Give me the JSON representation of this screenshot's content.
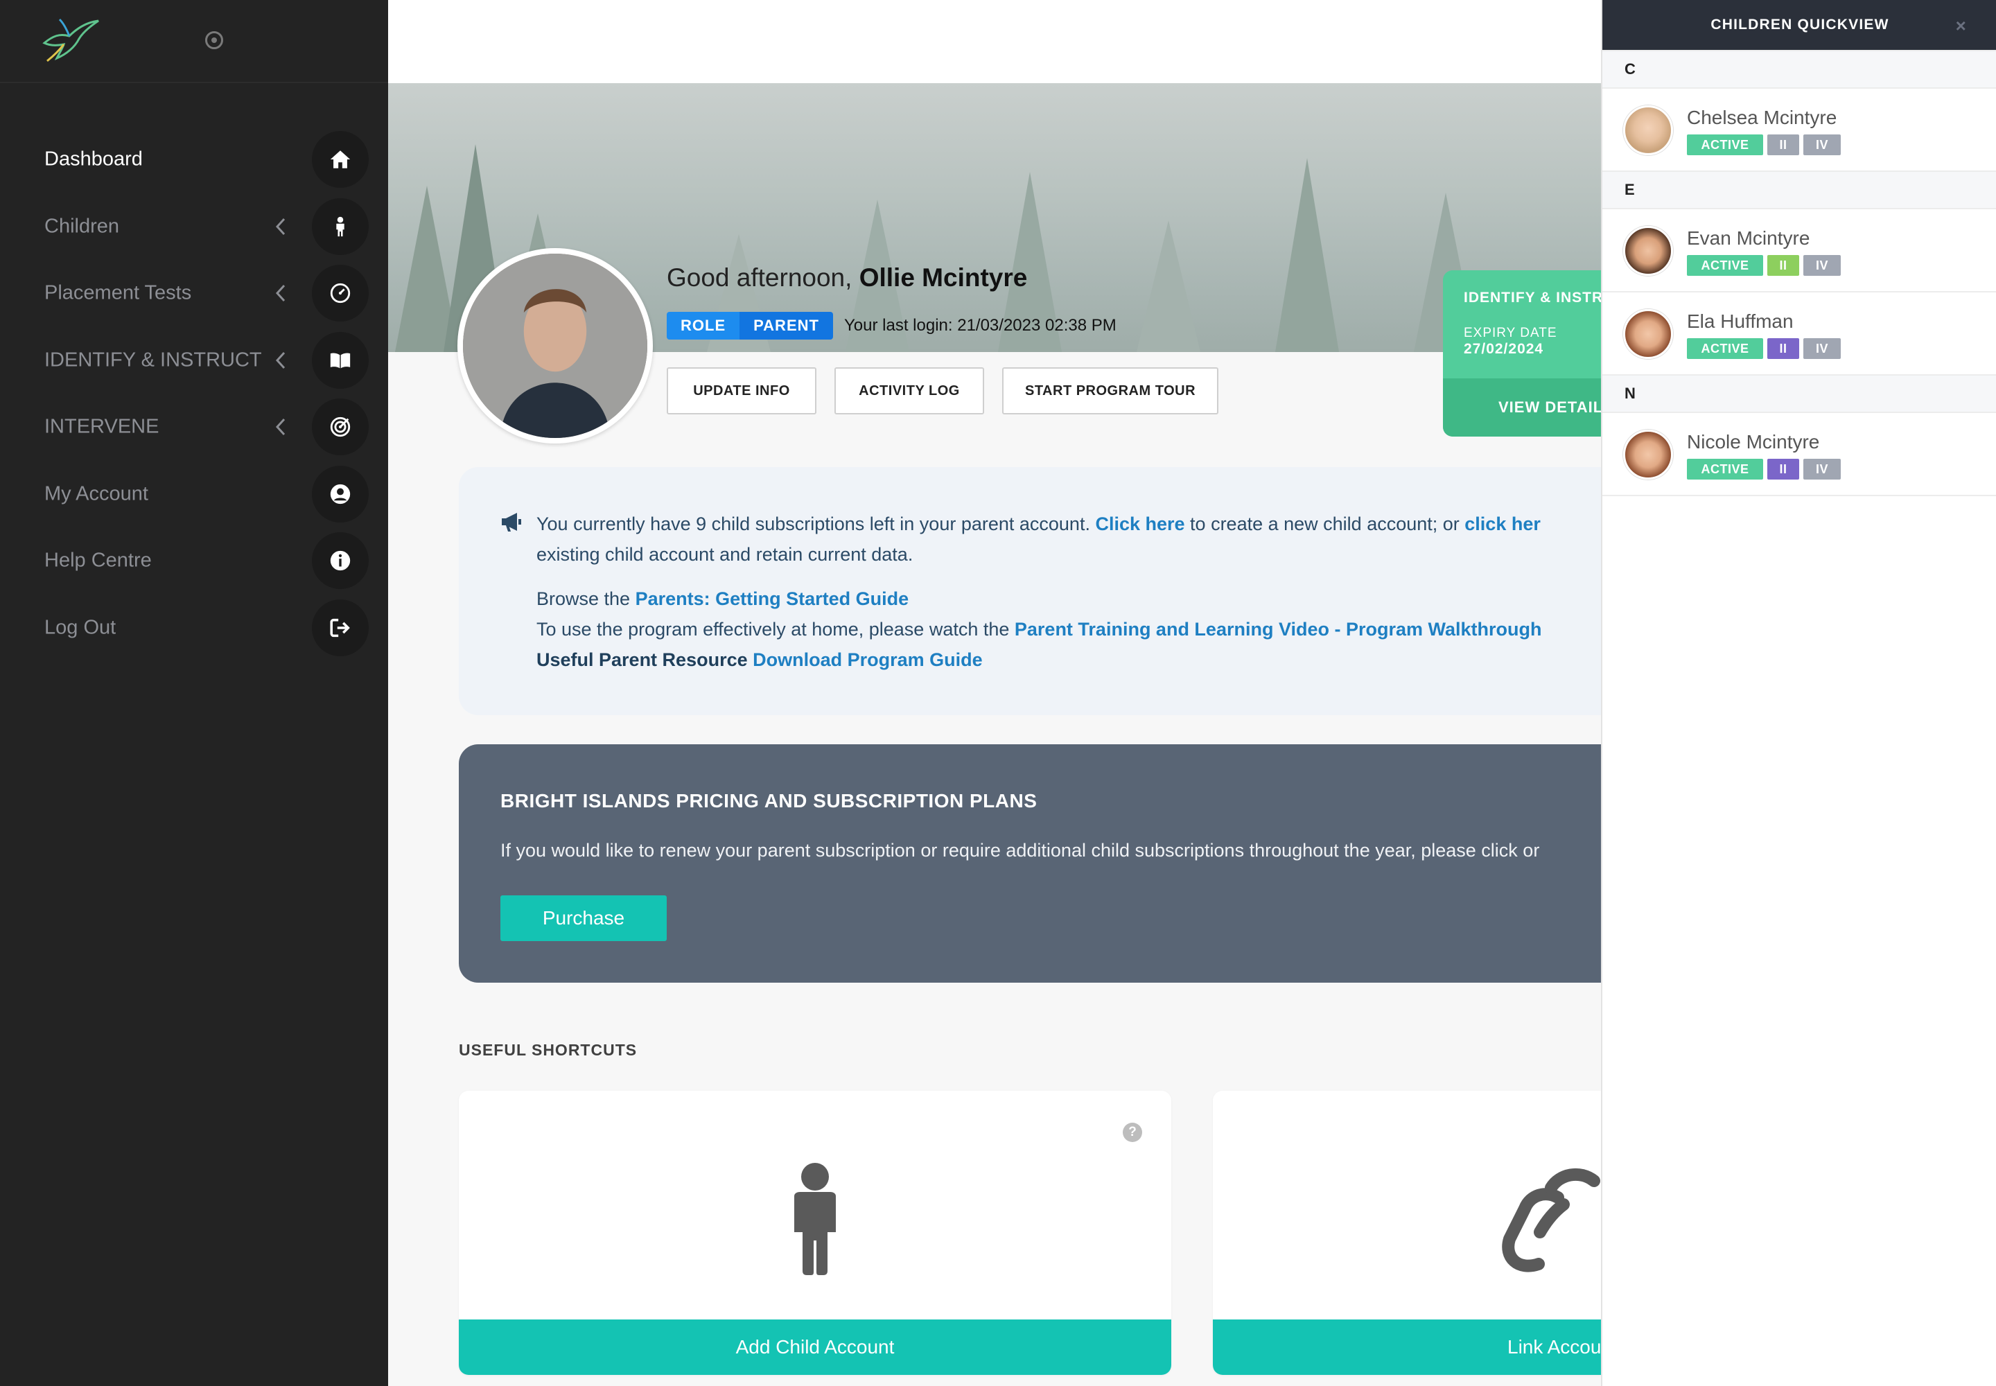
{
  "sidebar": {
    "items": [
      {
        "label": "Dashboard",
        "icon": "home-icon",
        "active": true,
        "has_submenu": false
      },
      {
        "label": "Children",
        "icon": "child-icon",
        "active": false,
        "has_submenu": true
      },
      {
        "label": "Placement Tests",
        "icon": "gauge-icon",
        "active": false,
        "has_submenu": true
      },
      {
        "label": "IDENTIFY & INSTRUCT",
        "icon": "book-icon",
        "active": false,
        "has_submenu": true
      },
      {
        "label": "INTERVENE",
        "icon": "target-icon",
        "active": false,
        "has_submenu": true
      },
      {
        "label": "My Account",
        "icon": "user-circle-icon",
        "active": false,
        "has_submenu": false
      },
      {
        "label": "Help Centre",
        "icon": "info-icon",
        "active": false,
        "has_submenu": false
      },
      {
        "label": "Log Out",
        "icon": "logout-icon",
        "active": false,
        "has_submenu": false
      }
    ]
  },
  "profile": {
    "greeting": "Good afternoon,",
    "name": "Ollie Mcintyre",
    "role_label": "ROLE",
    "role_value": "PARENT",
    "last_login": "Your last login: 21/03/2023 02:38 PM",
    "buttons": {
      "update_info": "UPDATE INFO",
      "activity_log": "ACTIVITY LOG",
      "start_tour": "START PROGRAM TOUR"
    }
  },
  "subscription_card": {
    "title": "IDENTIFY & INSTR",
    "expiry_label": "EXPIRY DATE",
    "expiry_value": "27/02/2024",
    "footer": "VIEW DETAIL"
  },
  "info": {
    "line1_a": "You currently have 9 child subscriptions left in your parent account. ",
    "line1_link": "Click here",
    "line1_b": " to create a new child account; or ",
    "line1_link2": "click her",
    "line2": "existing child account and retain current data.",
    "browse_prefix": "Browse the ",
    "browse_link": "Parents: Getting Started Guide",
    "video_prefix": "To use the program effectively at home, please watch the ",
    "video_link": "Parent Training and Learning Video - Program Walkthrough",
    "resource_label": "Useful Parent Resource ",
    "resource_link": "Download Program Guide"
  },
  "pricing": {
    "title": "BRIGHT ISLANDS PRICING AND SUBSCRIPTION PLANS",
    "text": "If you would like to renew your parent subscription or require additional child subscriptions throughout the year, please click or",
    "button": "Purchase"
  },
  "shortcuts": {
    "title": "USEFUL SHORTCUTS",
    "cards": [
      {
        "label": "Add Child Account",
        "icon": "child-icon",
        "help": "?"
      },
      {
        "label": "Link Accou",
        "icon": "link-icon"
      }
    ]
  },
  "quickview": {
    "title": "CHILDREN QUICKVIEW",
    "close": "×",
    "groups": [
      {
        "letter": "C",
        "children": [
          {
            "name": "Chelsea Mcintyre",
            "status": "ACTIVE",
            "levels": [
              "II",
              "IV"
            ],
            "level_colors": [
              "#a0a6b2",
              "#a0a6b2"
            ]
          }
        ]
      },
      {
        "letter": "E",
        "children": [
          {
            "name": "Evan Mcintyre",
            "status": "ACTIVE",
            "levels": [
              "II",
              "IV"
            ],
            "level_colors": [
              "#8dcf5e",
              "#a0a6b2"
            ]
          },
          {
            "name": "Ela Huffman",
            "status": "ACTIVE",
            "levels": [
              "II",
              "IV"
            ],
            "level_colors": [
              "#7b66c9",
              "#a0a6b2"
            ]
          }
        ]
      },
      {
        "letter": "N",
        "children": [
          {
            "name": "Nicole Mcintyre",
            "status": "ACTIVE",
            "levels": [
              "II",
              "IV"
            ],
            "level_colors": [
              "#7b66c9",
              "#a0a6b2"
            ]
          }
        ]
      }
    ]
  },
  "colors": {
    "sidebar_bg": "#232323",
    "teal": "#14c3b3",
    "green": "#52cd9b",
    "role_blue": "#1d8cef",
    "link_blue": "#1e7fc2",
    "pricing_bg": "#596575"
  }
}
